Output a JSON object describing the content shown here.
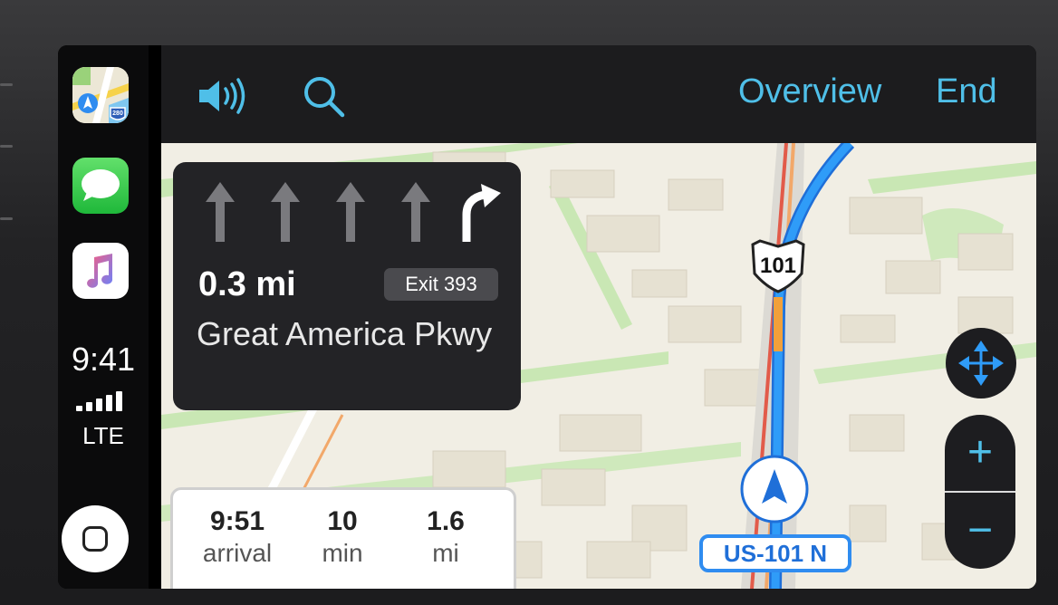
{
  "sidebar": {
    "apps": [
      {
        "name": "Maps",
        "badge": "280"
      },
      {
        "name": "Messages"
      },
      {
        "name": "Music"
      }
    ],
    "time": "9:41",
    "network": "LTE"
  },
  "topbar": {
    "volume_icon": "speaker-wave-icon",
    "search_icon": "magnifier-icon",
    "overview_label": "Overview",
    "end_label": "End",
    "accent_color": "#4fbfe8"
  },
  "guidance": {
    "distance": "0.3 mi",
    "exit": "Exit 393",
    "street": "Great America Pkwy",
    "lanes": [
      "straight",
      "straight",
      "straight",
      "straight",
      "right-turn"
    ]
  },
  "eta": {
    "arrival_value": "9:51",
    "arrival_label": "arrival",
    "minutes_value": "10",
    "minutes_label": "min",
    "distance_value": "1.6",
    "distance_label": "mi"
  },
  "map": {
    "route_shield": "101",
    "current_road": "US-101 N",
    "route_color": "#2f8cf0"
  },
  "controls": {
    "zoom_in": "+",
    "zoom_out": "−"
  }
}
